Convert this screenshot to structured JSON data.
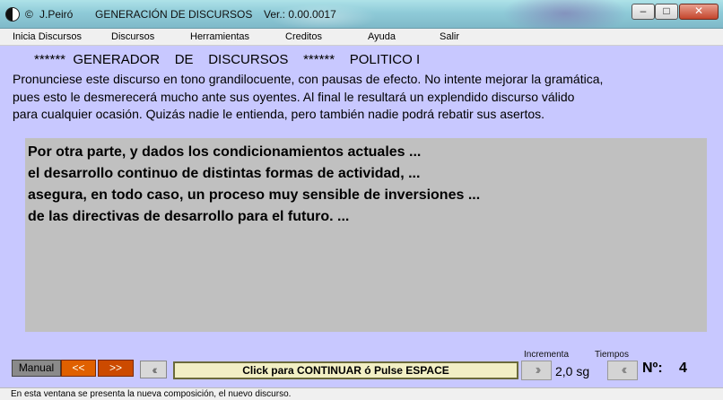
{
  "window": {
    "copyright_symbol": "©",
    "author": "J.Peiró",
    "app_title": "GENERACIÓN DE DISCURSOS",
    "version": "Ver.: 0.00.0017",
    "minimize_glyph": "–",
    "maximize_glyph": "□",
    "close_glyph": "✕"
  },
  "menu": {
    "items": [
      "Inicia Discursos",
      "Discursos",
      "Herramientas",
      "Creditos",
      "Ayuda",
      "Salir"
    ]
  },
  "content": {
    "heading": "******  GENERADOR    DE    DISCURSOS    ******    POLITICO I",
    "intro_lines": [
      "Pronunciese este discurso en tono grandilocuente, con pausas de efecto. No intente mejorar la gramática,",
      "pues esto le desmerecerá mucho ante sus oyentes. Al final le resultará un explendido discurso válido",
      "para cualquier ocasión. Quizás nadie le entienda, pero también nadie podrá rebatir sus asertos."
    ],
    "speech_lines": [
      "Por otra parte, y dados los condicionamientos actuales ...",
      "el desarrollo continuo de distintas formas de actividad, ...",
      "asegura, en todo caso, un proceso muy sensible de inversiones ...",
      "de las directivas de desarrollo para el futuro. ..."
    ]
  },
  "controls": {
    "manual_label": "Manual",
    "prev_label": "<<",
    "next_label": ">>",
    "rewind_glyph": "‹‹",
    "continue_label": "Click para CONTINUAR ó Pulse ESPACE",
    "incrementa_label": "Incrementa",
    "tiempos_label": "Tiempos",
    "inc_glyph": "››",
    "tiempos_glyph": "‹‹",
    "increment_value": "2,0 sg",
    "number_label": "Nº:",
    "number_value": "4"
  },
  "status": {
    "text": "En esta ventana se presenta la nueva composición, el nuevo discurso."
  }
}
